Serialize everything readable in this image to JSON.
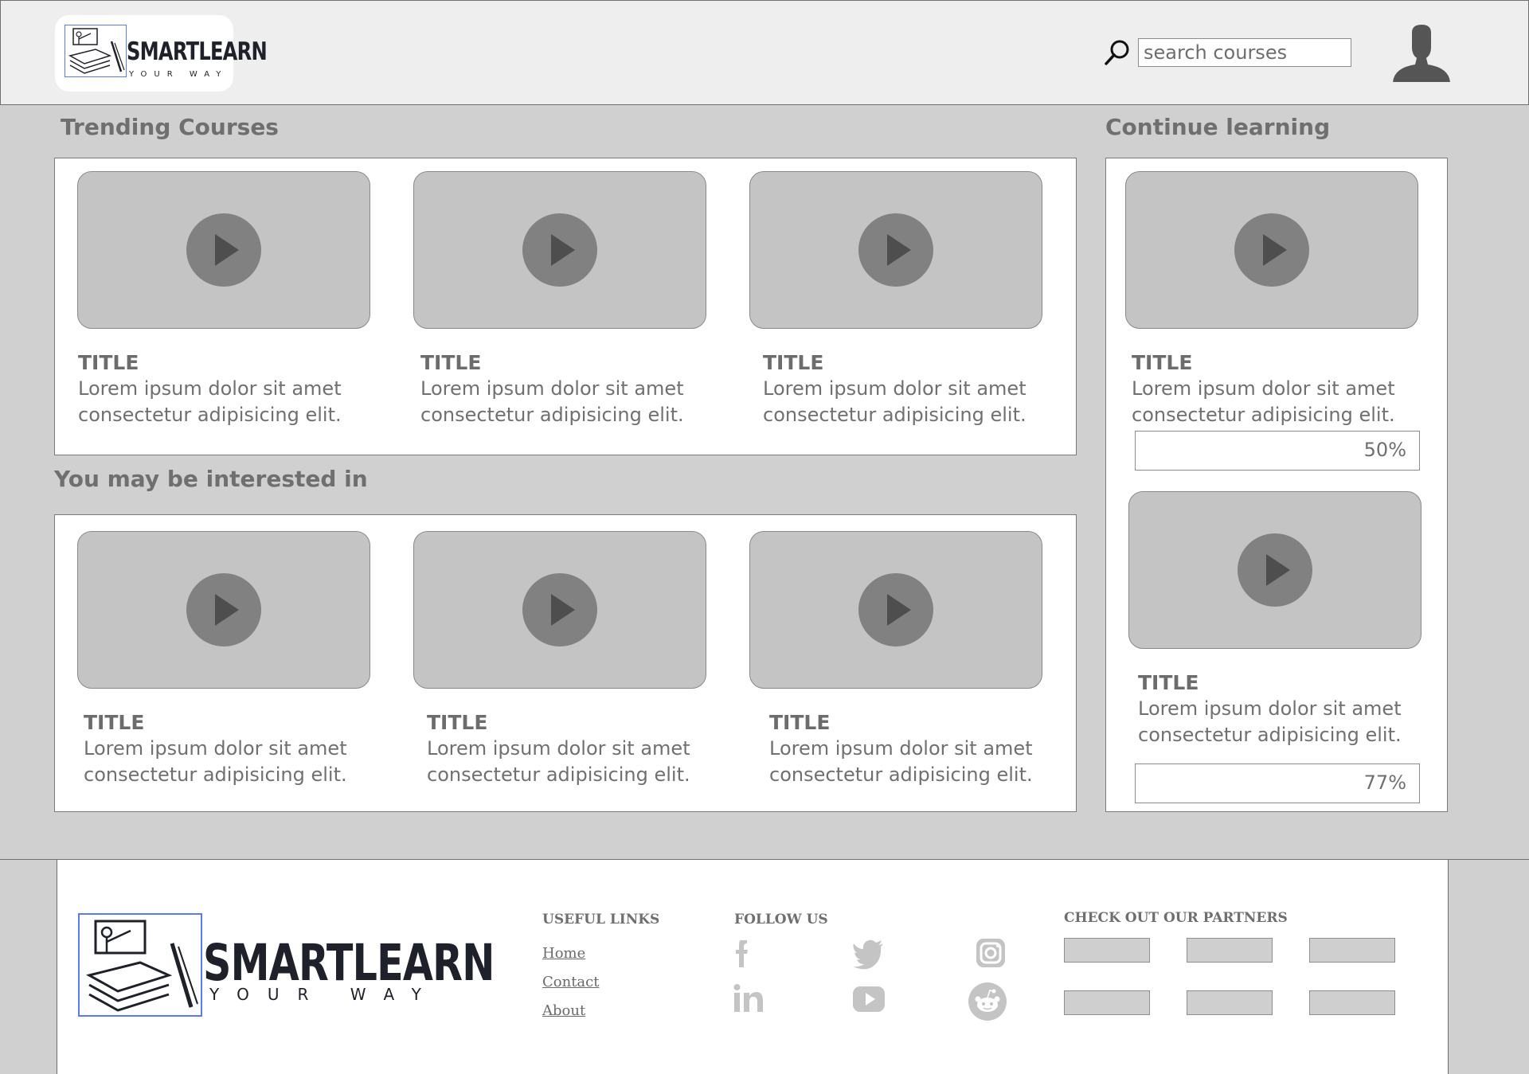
{
  "header": {
    "logo": {
      "word": "SMARTLEARN",
      "tagline": "YOUR WAY"
    },
    "search": {
      "placeholder": "search courses"
    }
  },
  "trending": {
    "heading": "Trending Courses",
    "cards": [
      {
        "title": "TITLE",
        "desc": "Lorem ipsum dolor sit amet consectetur adipisicing elit."
      },
      {
        "title": "TITLE",
        "desc": "Lorem ipsum dolor sit amet consectetur adipisicing elit."
      },
      {
        "title": "TITLE",
        "desc": "Lorem ipsum dolor sit amet consectetur adipisicing elit."
      }
    ]
  },
  "interested": {
    "heading": "You may be interested in",
    "cards": [
      {
        "title": "TITLE",
        "desc": "Lorem ipsum dolor sit amet consectetur adipisicing elit."
      },
      {
        "title": "TITLE",
        "desc": "Lorem ipsum dolor sit amet consectetur adipisicing elit."
      },
      {
        "title": "TITLE",
        "desc": "Lorem ipsum dolor sit amet consectetur adipisicing elit."
      }
    ]
  },
  "continue": {
    "heading": "Continue learning",
    "cards": [
      {
        "title": "TITLE",
        "desc": "Lorem ipsum dolor sit amet consectetur adipisicing elit.",
        "progress_label": "50%",
        "progress": 0.5
      },
      {
        "title": "TITLE",
        "desc": "Lorem ipsum dolor sit amet consectetur adipisicing elit.",
        "progress_label": "77%",
        "progress": 0.77
      }
    ]
  },
  "footer": {
    "logo": {
      "word": "SMARTLEARN",
      "tagline": "YOUR WAY"
    },
    "useful_links": {
      "heading": "USEFUL LINKS",
      "items": [
        "Home",
        "Contact",
        "About"
      ]
    },
    "follow_us": {
      "heading": "FOLLOW US",
      "icons": [
        "facebook-icon",
        "twitter-icon",
        "instagram-icon",
        "linkedin-icon",
        "youtube-icon",
        "reddit-icon"
      ]
    },
    "partners": {
      "heading": "CHECK OUT OUR PARTNERS",
      "count": 6
    }
  },
  "colors": {
    "page_bg": "#d0d0d0",
    "header_bg": "#eeeeee",
    "thumb_bg": "#c4c4c4",
    "play_button": "#818181",
    "logo_frame": "#5a7cf0",
    "text": "#707070"
  }
}
